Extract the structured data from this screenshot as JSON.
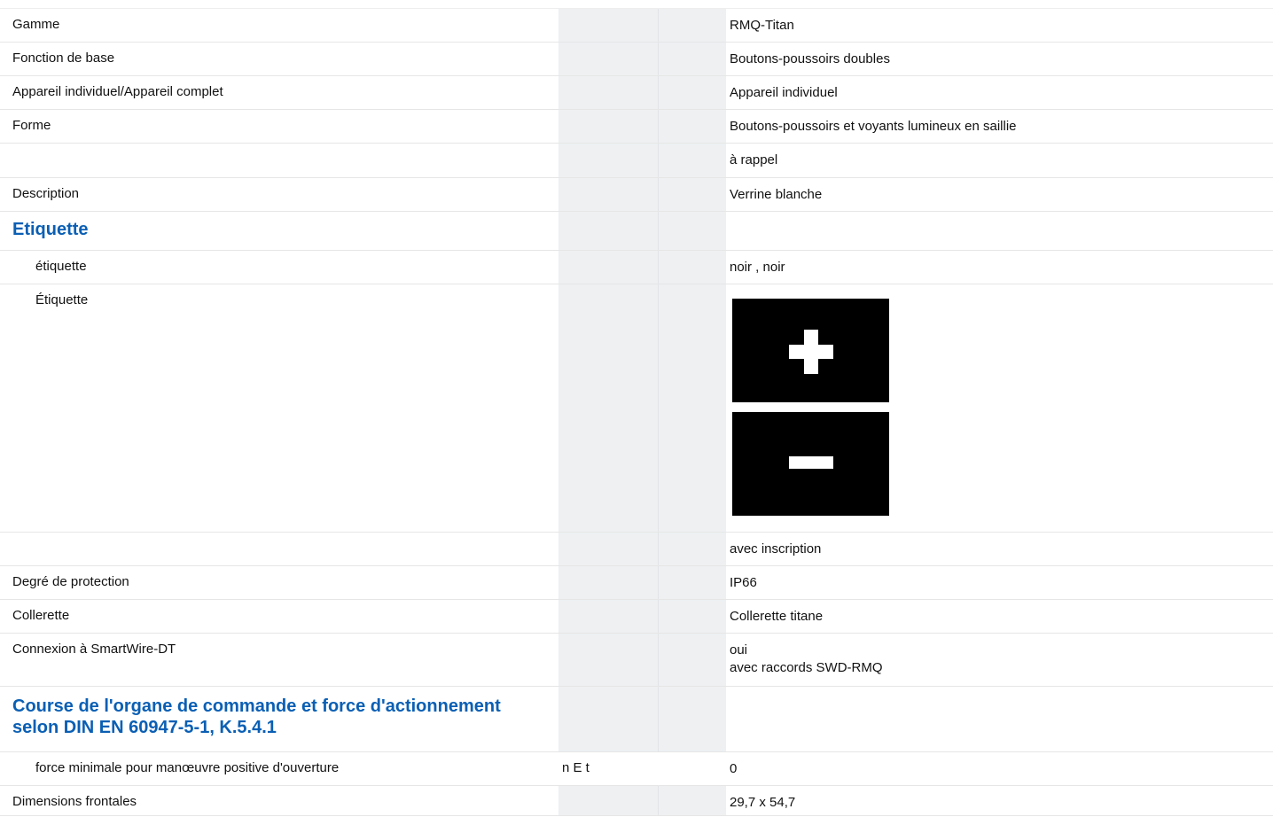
{
  "rows": [
    {
      "label": "Gamme",
      "symbol": "",
      "value": "RMQ-Titan"
    },
    {
      "label": "Fonction de base",
      "symbol": "",
      "value": "Boutons-poussoirs doubles"
    },
    {
      "label": "Appareil individuel/Appareil complet",
      "symbol": "",
      "value": "Appareil individuel"
    },
    {
      "label": "Forme",
      "symbol": "",
      "value": "Boutons-poussoirs et voyants lumineux en saillie"
    },
    {
      "label": "",
      "symbol": "",
      "value": "à rappel"
    },
    {
      "label": "Description",
      "symbol": "",
      "value": "Verrine blanche"
    }
  ],
  "section_etiquette": {
    "title": "Etiquette",
    "rows": [
      {
        "label": "étiquette",
        "symbol": "",
        "value": "noir , noir"
      },
      {
        "label": "Étiquette",
        "symbol": "",
        "images": [
          "plus-sign-label",
          "minus-sign-label"
        ]
      }
    ],
    "after_rows": [
      {
        "label": "",
        "symbol": "",
        "value": "avec inscription"
      },
      {
        "label": "Degré de protection",
        "symbol": "",
        "value": "IP66"
      },
      {
        "label": "Collerette",
        "symbol": "",
        "value": "Collerette titane"
      },
      {
        "label": "Connexion à SmartWire-DT",
        "symbol": "",
        "value_lines": [
          "oui",
          "avec raccords SWD-RMQ"
        ]
      }
    ]
  },
  "section_course": {
    "title_lines": [
      "Course de l'organe de commande et force d'actionnement",
      "selon DIN EN 60947-5-1, K.5.4.1"
    ],
    "rows": [
      {
        "label": "force minimale pour manœuvre positive d'ouverture",
        "symbol": "n E t",
        "value": "0"
      }
    ]
  },
  "final_rows": [
    {
      "label": "Dimensions frontales",
      "symbol": "",
      "value": "29,7 x 54,7"
    }
  ],
  "colors": {
    "heading": "#0a5fb4",
    "symbol_column_bg": "#eef0f2",
    "row_divider": "#e6e6e6"
  }
}
